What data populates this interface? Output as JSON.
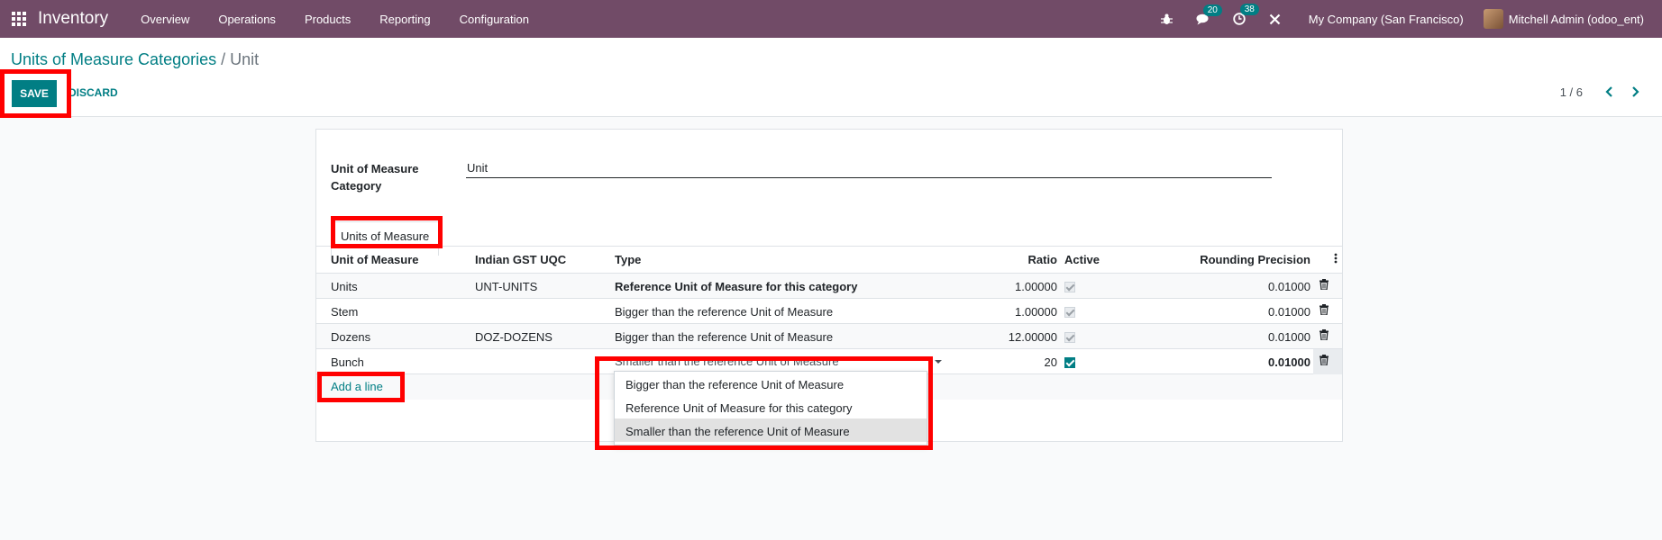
{
  "navbar": {
    "app_name": "Inventory",
    "menu": [
      "Overview",
      "Operations",
      "Products",
      "Reporting",
      "Configuration"
    ],
    "messages_badge": "20",
    "activities_badge": "38",
    "company": "My Company (San Francisco)",
    "user": "Mitchell Admin (odoo_ent)"
  },
  "breadcrumb": {
    "parent": "Units of Measure Categories",
    "separator": "/",
    "current": "Unit"
  },
  "actions": {
    "save": "SAVE",
    "discard": "DISCARD"
  },
  "pager": "1 / 6",
  "form": {
    "category_label": "Unit of Measure Category",
    "category_value": "Unit",
    "tab_label": "Units of Measure"
  },
  "table": {
    "headers": {
      "uom": "Unit of Measure",
      "gst": "Indian GST UQC",
      "type": "Type",
      "ratio": "Ratio",
      "active": "Active",
      "rounding": "Rounding Precision"
    },
    "rows": [
      {
        "uom": "Units",
        "gst": "UNT-UNITS",
        "type": "Reference Unit of Measure for this category",
        "ratio": "1.00000",
        "rounding": "0.01000"
      },
      {
        "uom": "Stem",
        "gst": "",
        "type": "Bigger than the reference Unit of Measure",
        "ratio": "1.00000",
        "rounding": "0.01000"
      },
      {
        "uom": "Dozens",
        "gst": "DOZ-DOZENS",
        "type": "Bigger than the reference Unit of Measure",
        "ratio": "12.00000",
        "rounding": "0.01000"
      }
    ],
    "editing_row": {
      "uom": "Bunch",
      "type": "Smaller than the reference Unit of Measure",
      "ratio": "20",
      "rounding": "0.01000"
    },
    "add_line": "Add a line"
  },
  "dropdown": {
    "options": [
      "Bigger than the reference Unit of Measure",
      "Reference Unit of Measure for this category",
      "Smaller than the reference Unit of Measure"
    ],
    "highlighted_index": 2
  },
  "colors": {
    "navbar": "#714b67",
    "primary": "#017e84",
    "highlight": "#ff0000"
  }
}
